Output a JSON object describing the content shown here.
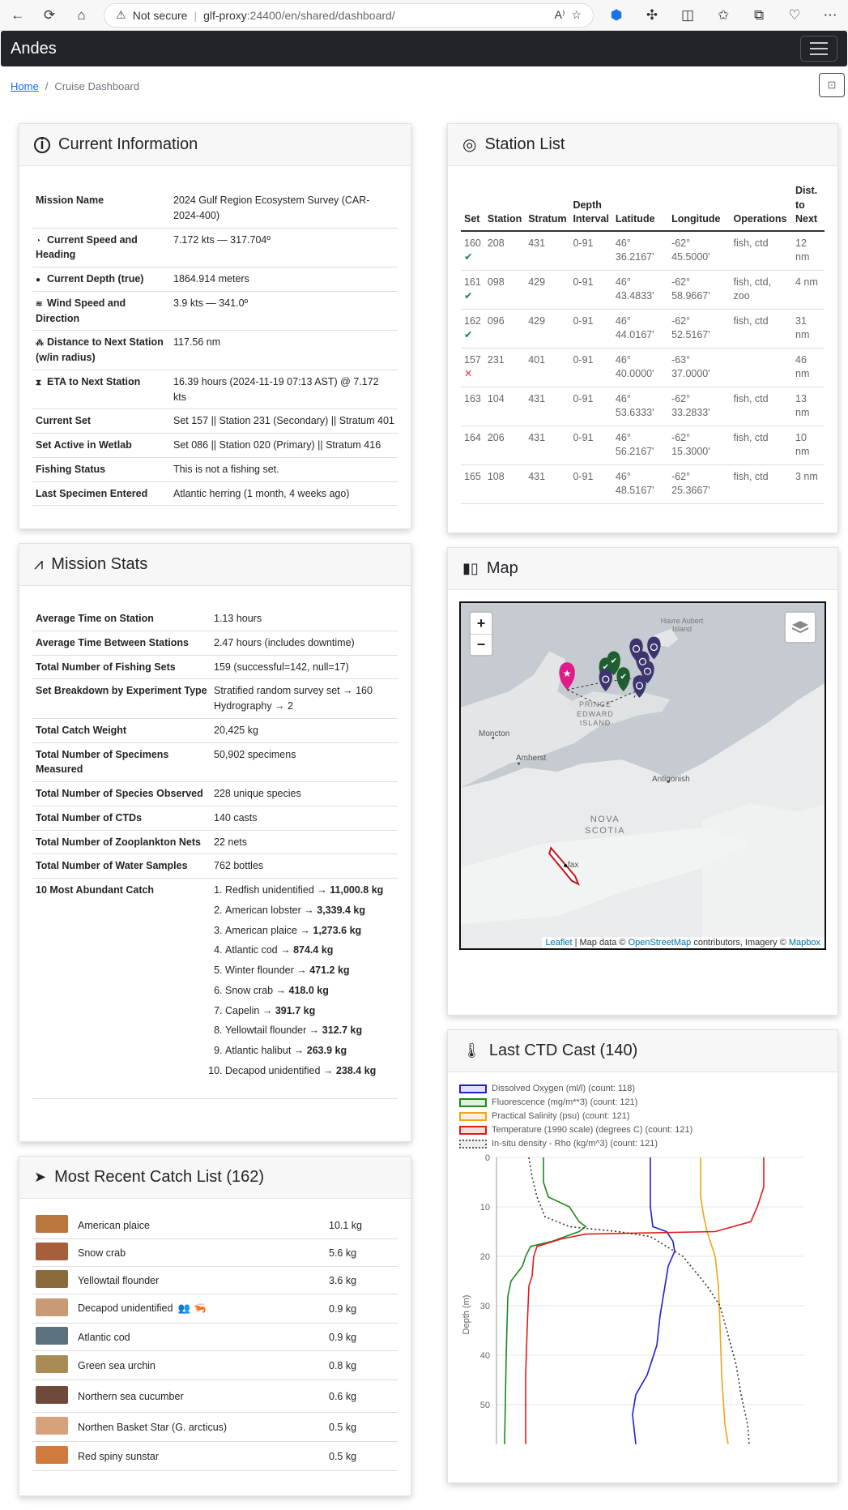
{
  "browser": {
    "security_text": "Not secure",
    "host": "glf-proxy",
    "port_path": ":24400/en/shared/dashboard/"
  },
  "navbar": {
    "brand": "Andes"
  },
  "breadcrumb": {
    "home": "Home",
    "current": "Cruise Dashboard"
  },
  "current_info": {
    "title": "Current Information",
    "rows": [
      {
        "key": "Mission Name",
        "value": "2024 Gulf Region Ecosystem Survey (CAR-2024-400)",
        "icon": ""
      },
      {
        "key": "Current Speed and Heading",
        "value": "7.172 kts — 317.704º",
        "icon": "gauge-icon"
      },
      {
        "key": "Current Depth (true)",
        "value": "1864.914 meters",
        "icon": "droplet-icon"
      },
      {
        "key": "Wind Speed and Direction",
        "value": "3.9 kts — 341.0º",
        "icon": "wind-icon"
      },
      {
        "key": "Distance to Next Station (w/in radius)",
        "value": "117.56 nm",
        "icon": "route-icon"
      },
      {
        "key": "ETA to Next Station",
        "value": "16.39 hours (2024-11-19 07:13 AST) @ 7.172 kts",
        "icon": "hourglass-icon"
      },
      {
        "key": "Current Set",
        "value": "Set 157 || Station 231 (Secondary) || Stratum 401",
        "icon": ""
      },
      {
        "key": "Set Active in Wetlab",
        "value": "Set 086 || Station 020 (Primary) || Stratum 416",
        "icon": ""
      },
      {
        "key": "Fishing Status",
        "value": "This is not a fishing set.",
        "icon": ""
      },
      {
        "key": "Last Specimen Entered",
        "value": "Atlantic herring (1 month, 4 weeks ago)",
        "icon": ""
      }
    ]
  },
  "station_list": {
    "title": "Station List",
    "headers": [
      "Set",
      "Station",
      "Stratum",
      "Depth Interval",
      "Latitude",
      "Longitude",
      "Operations",
      "Dist. to Next"
    ],
    "rows": [
      {
        "set": "160",
        "status": "✔",
        "ok": true,
        "station": "208",
        "stratum": "431",
        "depth": "0-91",
        "lat": "46° 36.2167'",
        "lon": "-62° 45.5000'",
        "ops": "fish, ctd",
        "dist": "12 nm"
      },
      {
        "set": "161",
        "status": "✔",
        "ok": true,
        "station": "098",
        "stratum": "429",
        "depth": "0-91",
        "lat": "46° 43.4833'",
        "lon": "-62° 58.9667'",
        "ops": "fish, ctd, zoo",
        "dist": "4 nm"
      },
      {
        "set": "162",
        "status": "✔",
        "ok": true,
        "station": "096",
        "stratum": "429",
        "depth": "0-91",
        "lat": "46° 44.0167'",
        "lon": "-62° 52.5167'",
        "ops": "fish, ctd",
        "dist": "31 nm"
      },
      {
        "set": "157",
        "status": "✕",
        "ok": false,
        "station": "231",
        "stratum": "401",
        "depth": "0-91",
        "lat": "46° 40.0000'",
        "lon": "-63° 37.0000'",
        "ops": "",
        "dist": "46 nm"
      },
      {
        "set": "163",
        "status": "",
        "ok": true,
        "station": "104",
        "stratum": "431",
        "depth": "0-91",
        "lat": "46° 53.6333'",
        "lon": "-62° 33.2833'",
        "ops": "fish, ctd",
        "dist": "13 nm"
      },
      {
        "set": "164",
        "status": "",
        "ok": true,
        "station": "206",
        "stratum": "431",
        "depth": "0-91",
        "lat": "46° 56.2167'",
        "lon": "-62° 15.3000'",
        "ops": "fish, ctd",
        "dist": "10 nm"
      },
      {
        "set": "165",
        "status": "",
        "ok": true,
        "station": "108",
        "stratum": "431",
        "depth": "0-91",
        "lat": "46° 48.5167'",
        "lon": "-62° 25.3667'",
        "ops": "fish, ctd",
        "dist": "3 nm"
      }
    ]
  },
  "mission_stats": {
    "title": "Mission Stats",
    "rows": [
      {
        "key": "Average Time on Station",
        "value": "1.13 hours"
      },
      {
        "key": "Average Time Between Stations",
        "value": "2.47 hours (includes downtime)"
      },
      {
        "key": "Total Number of Fishing Sets",
        "value": "159 (successful=142, null=17)"
      },
      {
        "key": "Set Breakdown by Experiment Type",
        "value": "Stratified random survey set → 160\nHydrography → 2"
      },
      {
        "key": "Total Catch Weight",
        "value": "20,425 kg"
      },
      {
        "key": "Total Number of Specimens Measured",
        "value": "50,902 specimens"
      },
      {
        "key": "Total Number of Species Observed",
        "value": "228 unique species"
      },
      {
        "key": "Total Number of CTDs",
        "value": "140 casts"
      },
      {
        "key": "Total Number of Zooplankton Nets",
        "value": "22 nets"
      },
      {
        "key": "Total Number of Water Samples",
        "value": "762 bottles"
      }
    ],
    "abundant_label": "10 Most Abundant Catch",
    "abundant": [
      {
        "name": "Redfish unidentified →",
        "weight": "11,000.8 kg"
      },
      {
        "name": "American lobster →",
        "weight": "3,339.4 kg"
      },
      {
        "name": "American plaice →",
        "weight": "1,273.6 kg"
      },
      {
        "name": "Atlantic cod →",
        "weight": "874.4 kg"
      },
      {
        "name": "Winter flounder →",
        "weight": "471.2 kg"
      },
      {
        "name": "Snow crab →",
        "weight": "418.0 kg"
      },
      {
        "name": "Capelin →",
        "weight": "391.7 kg"
      },
      {
        "name": "Yellowtail flounder →",
        "weight": "312.7 kg"
      },
      {
        "name": "Atlantic halibut →",
        "weight": "263.9 kg"
      },
      {
        "name": "Decapod unidentified →",
        "weight": "238.4 kg"
      }
    ]
  },
  "map": {
    "title": "Map",
    "labels": {
      "havre": "Havre Aubert Island",
      "pei": "PRINCE EDWARD ISLAND",
      "moncton": "Moncton",
      "amherst": "Amherst",
      "antigonish": "Antigonish",
      "nova": "NOVA SCOTIA",
      "halifax": "fax"
    },
    "zoom_in": "+",
    "zoom_out": "−",
    "attribution": {
      "leaflet": "Leaflet",
      "sep1": " | Map data © ",
      "osm": "OpenStreetMap",
      "mid": " contributors, Imagery © ",
      "mapbox": "Mapbox"
    }
  },
  "ctd": {
    "title": "Last CTD Cast (140)",
    "legend": [
      {
        "label": "Dissolved Oxygen (ml/l) (count: 118)",
        "color": "#1f1fd6",
        "fill": "#e3e3f7"
      },
      {
        "label": "Fluorescence (mg/m**3) (count: 121)",
        "color": "#1a8a1a",
        "fill": "#e1f0e1"
      },
      {
        "label": "Practical Salinity (psu) (count: 121)",
        "color": "#f2a516",
        "fill": "#fbf0dc"
      },
      {
        "label": "Temperature (1990 scale) (degrees C) (count: 121)",
        "color": "#e01b1b",
        "fill": "#f8dede"
      },
      {
        "label": "In-situ density - Rho (kg/m^3) (count: 121)",
        "color": "#555555",
        "fill": "#eeeeee"
      }
    ],
    "y_label": "Depth (m)",
    "y_ticks": [
      "0",
      "10",
      "20",
      "30",
      "40",
      "50"
    ]
  },
  "catch_list": {
    "title": "Most Recent Catch List (162)",
    "items": [
      {
        "name": "American plaice",
        "weight": "10.1 kg",
        "color": "#b9773e"
      },
      {
        "name": "Snow crab",
        "weight": "5.6 kg",
        "color": "#a75e3a"
      },
      {
        "name": "Yellowtail flounder",
        "weight": "3.6 kg",
        "color": "#8a6b3b"
      },
      {
        "name": "Decapod unidentified",
        "weight": "0.9 kg",
        "color": "#c89a75"
      },
      {
        "name": "Atlantic cod",
        "weight": "0.9 kg",
        "color": "#5d7281"
      },
      {
        "name": "Green sea urchin",
        "weight": "0.8 kg",
        "color": "#a98c55"
      },
      {
        "name": "Northern sea cucumber",
        "weight": "0.6 kg",
        "color": "#6e4a3a"
      },
      {
        "name": "Northen Basket Star (G. arcticus)",
        "weight": "0.5 kg",
        "color": "#d6a27c"
      },
      {
        "name": "Red spiny sunstar",
        "weight": "0.5 kg",
        "color": "#d07a3d"
      }
    ]
  }
}
